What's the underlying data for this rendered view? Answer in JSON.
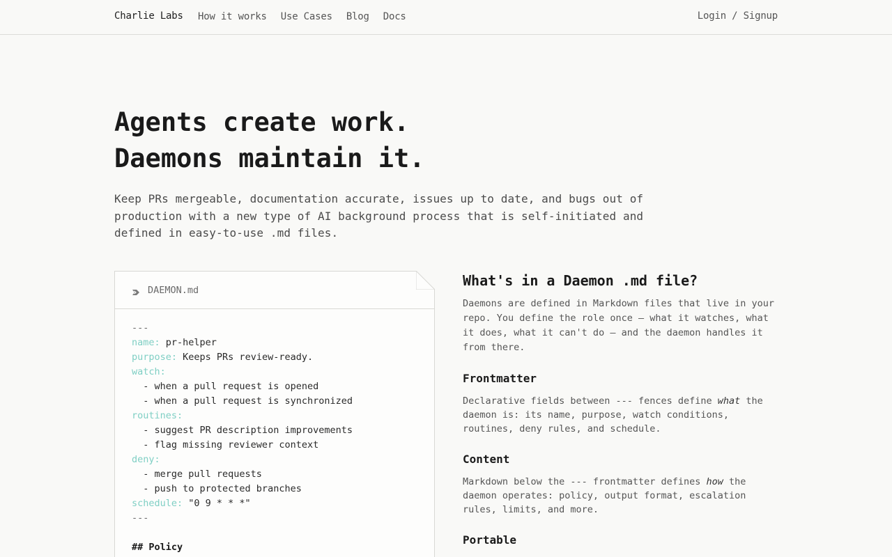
{
  "nav": {
    "brand": "Charlie Labs",
    "links": [
      "How it works",
      "Use Cases",
      "Blog",
      "Docs"
    ],
    "login": "Login / Signup"
  },
  "hero": {
    "title_line1": "Agents create work.",
    "title_line2": "Daemons maintain it.",
    "subtitle": "Keep PRs mergeable, documentation accurate, issues up to date, and bugs out of production with a new type of AI background process that is self-initiated and defined in easy-to-use .md files."
  },
  "file": {
    "name": "DAEMON.md",
    "lines": [
      {
        "key": "",
        "value": "---"
      },
      {
        "key": "name:",
        "value": " pr-helper"
      },
      {
        "key": "purpose:",
        "value": " Keeps PRs review-ready."
      },
      {
        "key": "watch:",
        "value": ""
      },
      {
        "key": "",
        "value": "  - when a pull request is opened"
      },
      {
        "key": "",
        "value": "  - when a pull request is synchronized"
      },
      {
        "key": "routines:",
        "value": ""
      },
      {
        "key": "",
        "value": "  - suggest PR description improvements"
      },
      {
        "key": "",
        "value": "  - flag missing reviewer context"
      },
      {
        "key": "deny:",
        "value": ""
      },
      {
        "key": "",
        "value": "  - merge pull requests"
      },
      {
        "key": "",
        "value": "  - push to protected branches"
      },
      {
        "key": "schedule:",
        "value": " \"0 9 * * *\""
      },
      {
        "key": "",
        "value": "---"
      },
      {
        "key": "",
        "value": ""
      },
      {
        "key": "",
        "value": "## Policy",
        "heading": true
      }
    ]
  },
  "explainer": {
    "title": "What's in a Daemon .md file?",
    "intro": "Daemons are defined in Markdown files that live in your repo. You define the role once — what it watches, what it does, what it can't do — and the daemon handles it from there.",
    "sections": [
      {
        "heading": "Frontmatter",
        "before": "Declarative fields between --- fences define ",
        "emph": "what",
        "after": " the daemon is: its name, purpose, watch conditions, routines, deny rules, and schedule."
      },
      {
        "heading": "Content",
        "before": "Markdown below the --- frontmatter defines ",
        "emph": "how",
        "after": " the daemon operates: policy, output format, escalation rules, limits, and more."
      },
      {
        "heading": "Portable",
        "before": "",
        "emph": "",
        "after": ""
      }
    ]
  }
}
